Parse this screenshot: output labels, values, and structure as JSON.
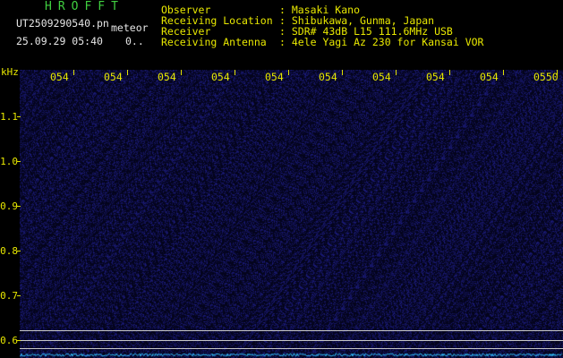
{
  "header": {
    "brand": "HROFFT",
    "filename": "UT2509290540.pn",
    "filetype": "meteor",
    "datetime": "25.09.29 05:40",
    "count": "0..",
    "fields": [
      {
        "label": "Observer",
        "value": ": Masaki Kano"
      },
      {
        "label": "Receiving Location",
        "value": ": Shibukawa, Gunma, Japan"
      },
      {
        "label": "Receiver",
        "value": ": SDR# 43dB L15 111.6MHz USB"
      },
      {
        "label": "Receiving Antenna",
        "value": ": 4ele Yagi Az 230 for Kansai VOR"
      }
    ]
  },
  "spectrogram": {
    "y_unit": "kHz",
    "y_ticks": [
      "1.1",
      "1.0",
      "0.9",
      "0.8",
      "0.7",
      "0.6"
    ],
    "x_ticks": [
      "054",
      "054",
      "054",
      "054",
      "054",
      "054",
      "054",
      "054",
      "054",
      "0550"
    ],
    "colors": {
      "background": "#04041c",
      "noise": "#202080",
      "reference_line": "#c8c8c8",
      "baseline": "#30c0ff"
    }
  }
}
